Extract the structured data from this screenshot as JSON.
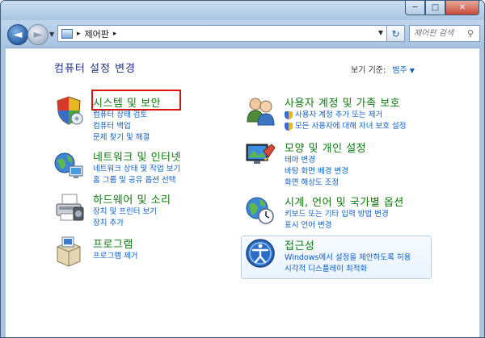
{
  "window": {
    "caption_buttons": {
      "minimize": "─",
      "maximize": "□",
      "close": "✕"
    }
  },
  "nav": {
    "back": "◄",
    "forward": "►",
    "address": {
      "separator": "▸",
      "path": "제어판",
      "trailing_separator": "▸"
    },
    "refresh": "↻",
    "search_placeholder": "제어판 검색",
    "search_icon": "magnifier-icon"
  },
  "main": {
    "title": "컴퓨터 설정 변경",
    "view_by": {
      "label": "보기 기준:",
      "value": "범주"
    }
  },
  "categories": {
    "system": {
      "title": "시스템 및 보안",
      "icon": "shield-icon",
      "links": [
        "컴퓨터 상태 검토",
        "컴퓨터 백업",
        "문제 찾기 및 해결"
      ]
    },
    "network": {
      "title": "네트워크 및 인터넷",
      "icon": "network-globe-icon",
      "links": [
        "네트워크 상태 및 작업 보기",
        "홈 그룹 및 공유 옵션 선택"
      ]
    },
    "hardware": {
      "title": "하드웨어 및 소리",
      "icon": "printer-icon",
      "links": [
        "장치 및 프린터 보기",
        "장치 추가"
      ]
    },
    "programs": {
      "title": "프로그램",
      "icon": "programs-box-icon",
      "links": [
        "프로그램 제거"
      ]
    },
    "users": {
      "title": "사용자 계정 및 가족 보호",
      "icon": "users-icon",
      "links": [
        "사용자 계정 추가 또는 제거",
        "모든 사용자에 대해 자녀 보호 설정"
      ]
    },
    "appearance": {
      "title": "모양 및 개인 설정",
      "icon": "appearance-monitor-icon",
      "links": [
        "테마 변경",
        "바탕 화면 배경 변경",
        "화면 해상도 조정"
      ]
    },
    "clock": {
      "title": "시계, 언어 및 국가별 옵션",
      "icon": "clock-globe-icon",
      "links": [
        "키보드 또는 기타 입력 방법 변경",
        "표시 언어 변경"
      ]
    },
    "access": {
      "title": "접근성",
      "icon": "accessibility-icon",
      "links": [
        "Windows에서 설정을 제안하도록 허용",
        "시각적 디스플레이 최적화"
      ]
    }
  },
  "colors": {
    "category_title": "#0d7a0d",
    "link": "#0b5fc8",
    "highlight": "#d7140f",
    "page_title": "#1e3287"
  }
}
